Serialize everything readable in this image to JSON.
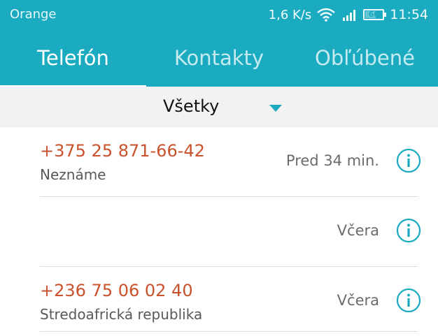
{
  "status_bar": {
    "carrier": "Orange",
    "speed": "1,6 K/s",
    "battery_level": "66",
    "battery_fraction": 0.66,
    "time": "11:54",
    "icons": [
      "wifi-icon",
      "signal-icon",
      "battery-icon"
    ]
  },
  "tabs": [
    {
      "label": "Telefón",
      "active": true
    },
    {
      "label": "Kontakty",
      "active": false
    },
    {
      "label": "Obľúbené",
      "active": false
    }
  ],
  "filter": {
    "selected": "Všetky",
    "icon": "dropdown-arrow-icon"
  },
  "calls": [
    {
      "number": "+375 25 871-66-42",
      "label": "Neznáme",
      "time": "Pred 34 min.",
      "icon": "info-icon"
    },
    {
      "number": "",
      "label": "",
      "time": "Včera",
      "icon": "info-icon"
    },
    {
      "number": "+236 75 06 02 40",
      "label": "Stredoafrická republika",
      "time": "Včera",
      "icon": "info-icon"
    }
  ],
  "colors": {
    "header_bg": "#1aabc0",
    "accent": "#1aabc0",
    "number_text": "#c9522c",
    "filter_bg": "#f2f2f2"
  }
}
